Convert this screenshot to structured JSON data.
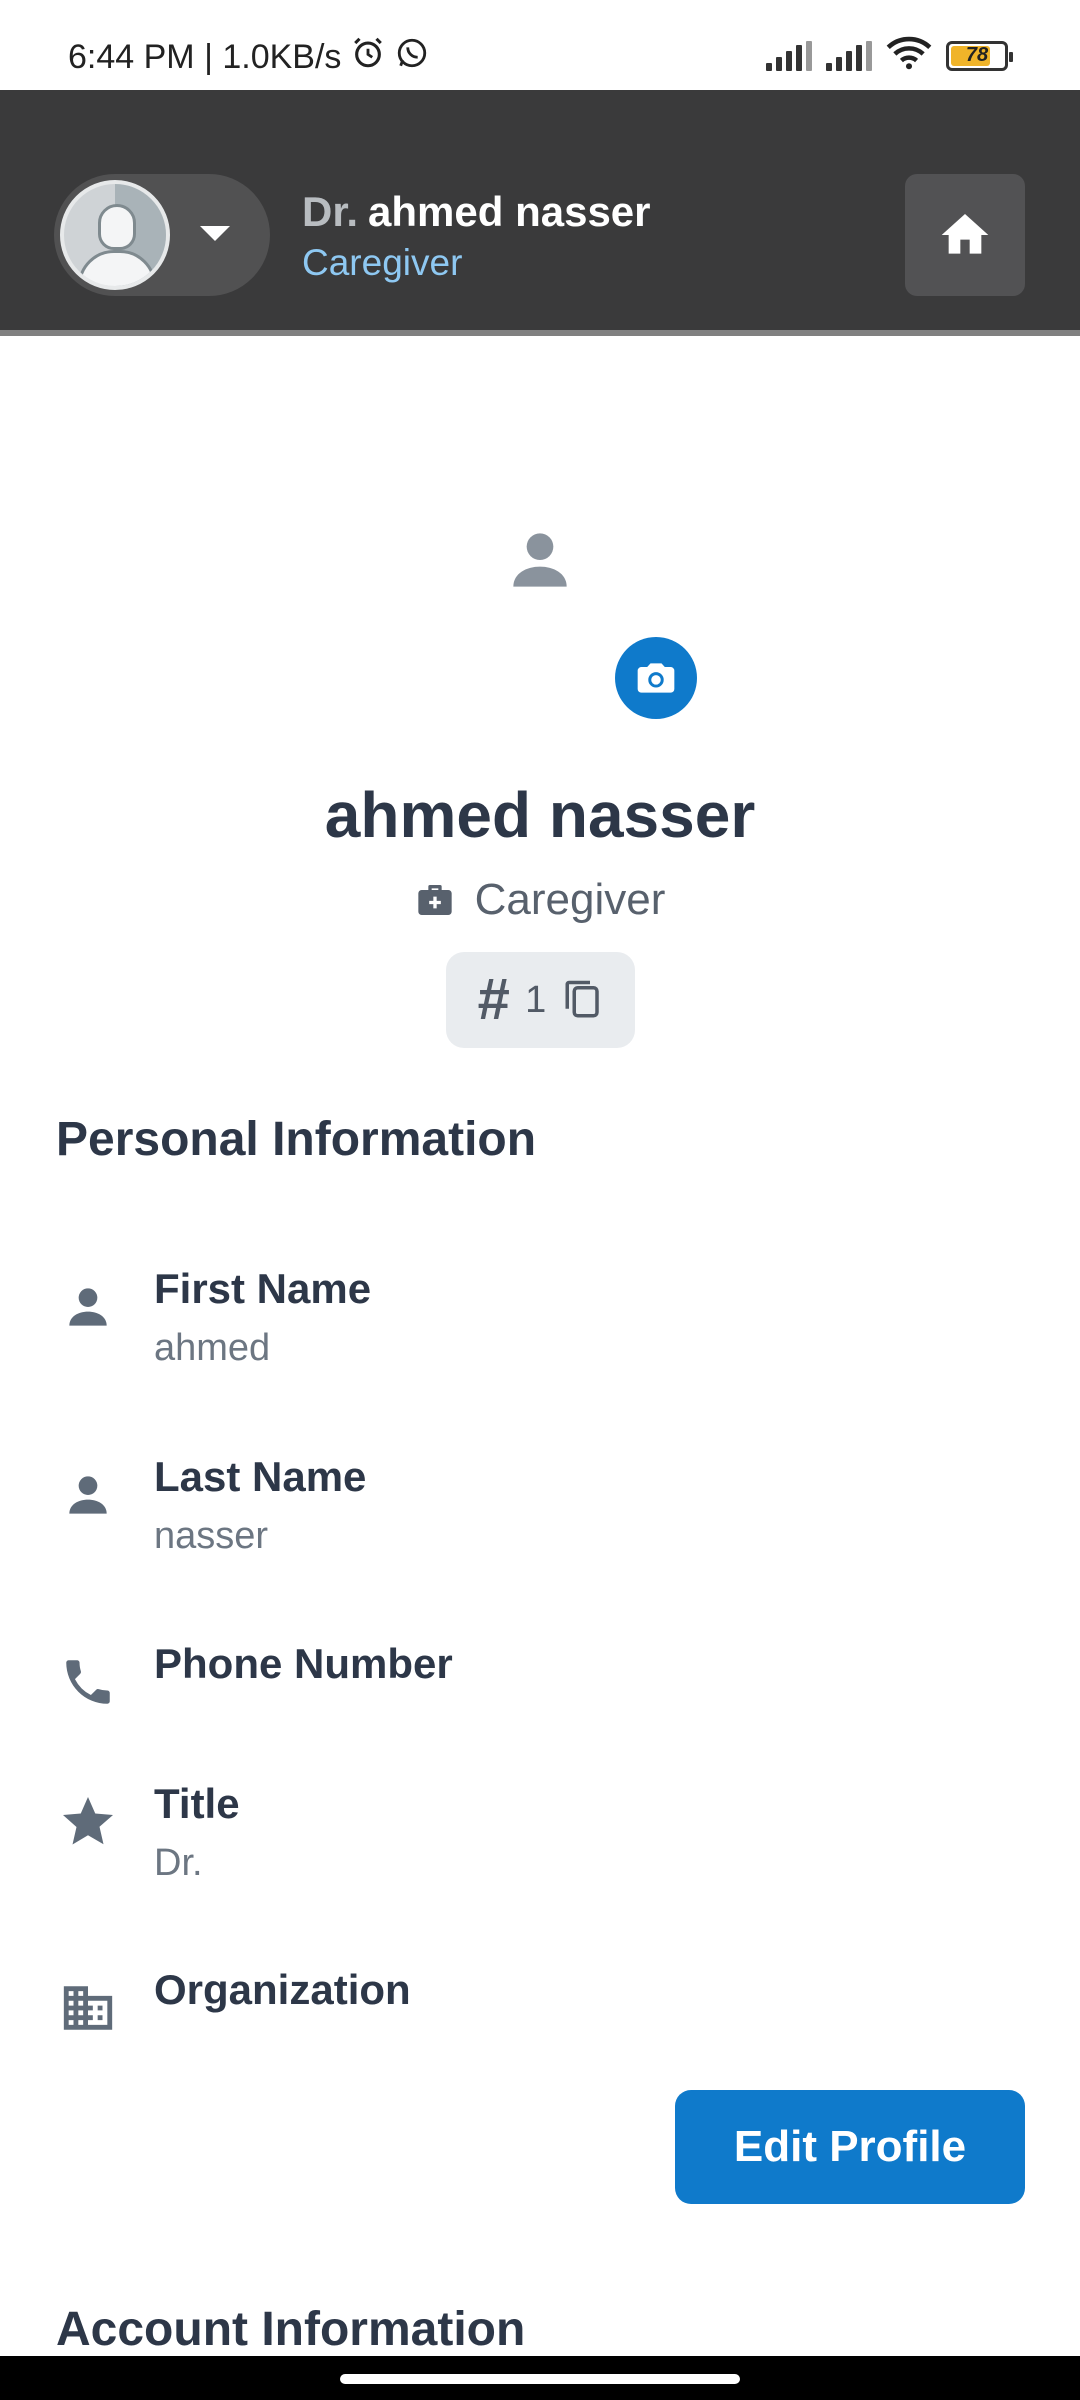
{
  "status_bar": {
    "time_speed": "6:44 PM | 1.0KB/s",
    "battery": "78"
  },
  "header": {
    "title_prefix": "Dr.",
    "user_name": "ahmed nasser",
    "role": "Caregiver"
  },
  "profile": {
    "name": "ahmed nasser",
    "role": "Caregiver",
    "id": "1"
  },
  "personal_info": {
    "section_title": "Personal Information",
    "fields": [
      {
        "label": "First Name",
        "value": "ahmed",
        "icon": "person-icon"
      },
      {
        "label": "Last Name",
        "value": "nasser",
        "icon": "person-icon"
      },
      {
        "label": "Phone Number",
        "value": "",
        "icon": "phone-icon"
      },
      {
        "label": "Title",
        "value": "Dr.",
        "icon": "star-icon"
      },
      {
        "label": "Organization",
        "value": "",
        "icon": "building-icon"
      }
    ]
  },
  "edit_button_label": "Edit Profile",
  "account_info": {
    "section_title": "Account Information"
  },
  "colors": {
    "header_bg": "#3a3a3b",
    "accent": "#0f7acb",
    "role_text": "#8ec8f2",
    "text_primary": "#2d3748",
    "text_secondary": "#6c7682"
  }
}
